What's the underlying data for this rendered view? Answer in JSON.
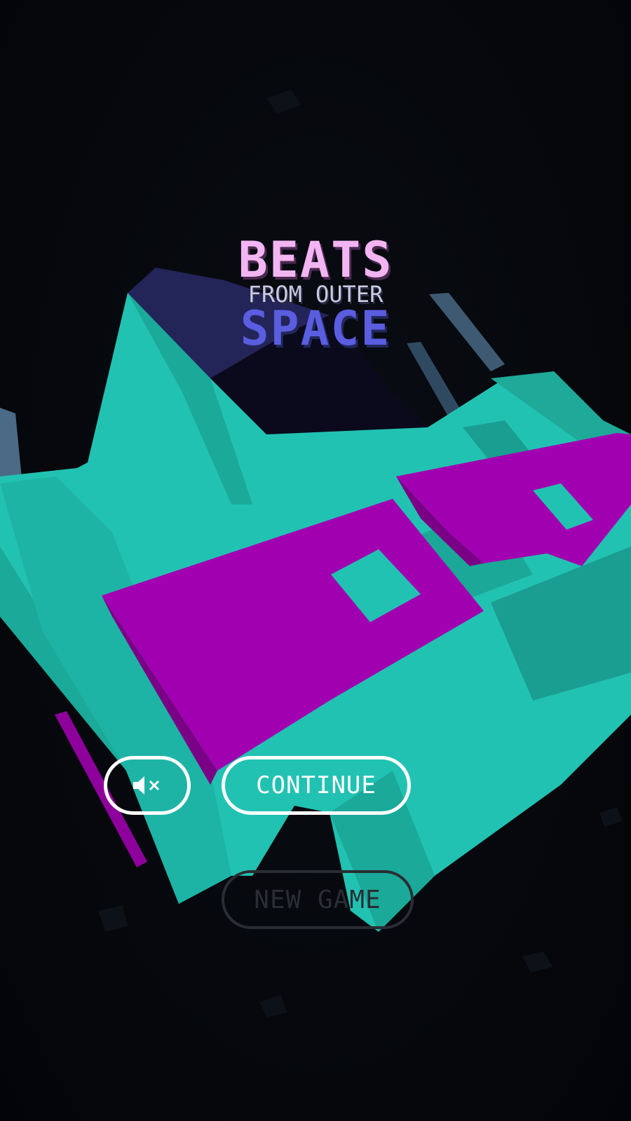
{
  "title": {
    "line1": "BEATS",
    "line2": "FROM OUTER",
    "line3": "SPACE"
  },
  "buttons": {
    "mute_icon": "speaker-muted-icon",
    "continue_label": "CONTINUE",
    "new_game_label": "NEW GAME"
  },
  "colors": {
    "background": "#05070c",
    "teal": "#22c2b2",
    "teal_dark": "#1a9e91",
    "magenta": "#a100b0",
    "navy": "#1f1f52",
    "title_pink": "#f2b5f2",
    "title_lavender": "#c9cbe2",
    "title_blue": "#5a5de0",
    "button_white": "#ffffff",
    "button_disabled": "#2a2d33"
  }
}
